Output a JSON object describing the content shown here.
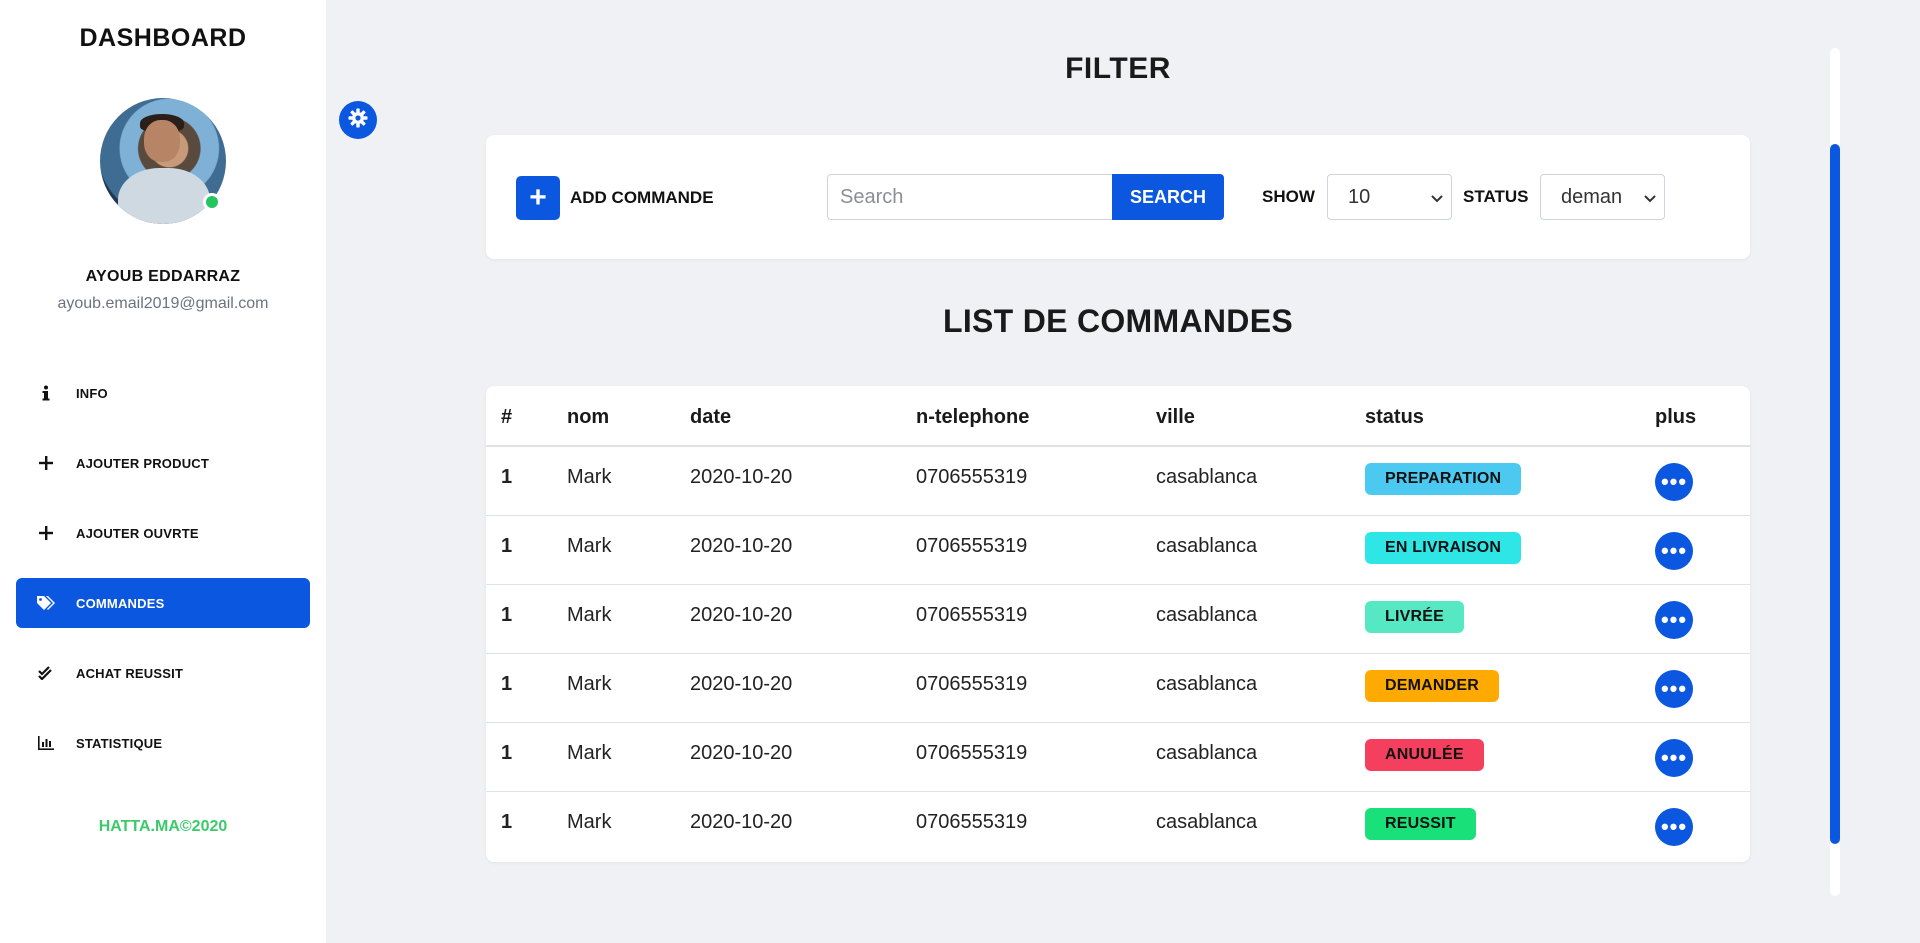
{
  "sidebar": {
    "title": "DASHBOARD",
    "user": {
      "name": "AYOUB EDDARRAZ",
      "email": "ayoub.email2019@gmail.com",
      "status": "online"
    },
    "items": [
      {
        "label": "INFO",
        "icon": "info-icon",
        "active": false
      },
      {
        "label": "AJOUTER PRODUCT",
        "icon": "plus-icon",
        "active": false
      },
      {
        "label": "AJOUTER OUVRTE",
        "icon": "plus-icon",
        "active": false
      },
      {
        "label": "COMMANDES",
        "icon": "tags-icon",
        "active": true
      },
      {
        "label": "ACHAT REUSSIT",
        "icon": "double-check-icon",
        "active": false
      },
      {
        "label": "STATISTIQUE",
        "icon": "bar-chart-icon",
        "active": false
      }
    ],
    "footer": "HATTA.MA©2020"
  },
  "filter": {
    "heading": "FILTER",
    "add_label": "ADD COMMANDE",
    "search_placeholder": "Search",
    "search_button": "SEARCH",
    "show_label": "SHOW",
    "show_value": "10",
    "status_label": "STATUS",
    "status_value": "deman"
  },
  "list": {
    "heading": "LIST DE COMMANDES",
    "columns": [
      "#",
      "nom",
      "date",
      "n-telephone",
      "ville",
      "status",
      "plus"
    ],
    "rows": [
      {
        "num": "1",
        "nom": "Mark",
        "date": "2020-10-20",
        "tel": "0706555319",
        "ville": "casablanca",
        "status": "PREPARATION",
        "status_color": "#4cc9f0"
      },
      {
        "num": "1",
        "nom": "Mark",
        "date": "2020-10-20",
        "tel": "0706555319",
        "ville": "casablanca",
        "status": "EN LIVRAISON",
        "status_color": "#2ee6e6"
      },
      {
        "num": "1",
        "nom": "Mark",
        "date": "2020-10-20",
        "tel": "0706555319",
        "ville": "casablanca",
        "status": "LIVRÉE",
        "status_color": "#55e8c3"
      },
      {
        "num": "1",
        "nom": "Mark",
        "date": "2020-10-20",
        "tel": "0706555319",
        "ville": "casablanca",
        "status": "DEMANDER",
        "status_color": "#ffaa00"
      },
      {
        "num": "1",
        "nom": "Mark",
        "date": "2020-10-20",
        "tel": "0706555319",
        "ville": "casablanca",
        "status": "ANUULÉE",
        "status_color": "#f43f5e"
      },
      {
        "num": "1",
        "nom": "Mark",
        "date": "2020-10-20",
        "tel": "0706555319",
        "ville": "casablanca",
        "status": "REUSSIT",
        "status_color": "#1ae07a"
      }
    ]
  },
  "colors": {
    "accent": "#0b57e0",
    "footer": "#3cc96b",
    "online": "#22c55e"
  }
}
